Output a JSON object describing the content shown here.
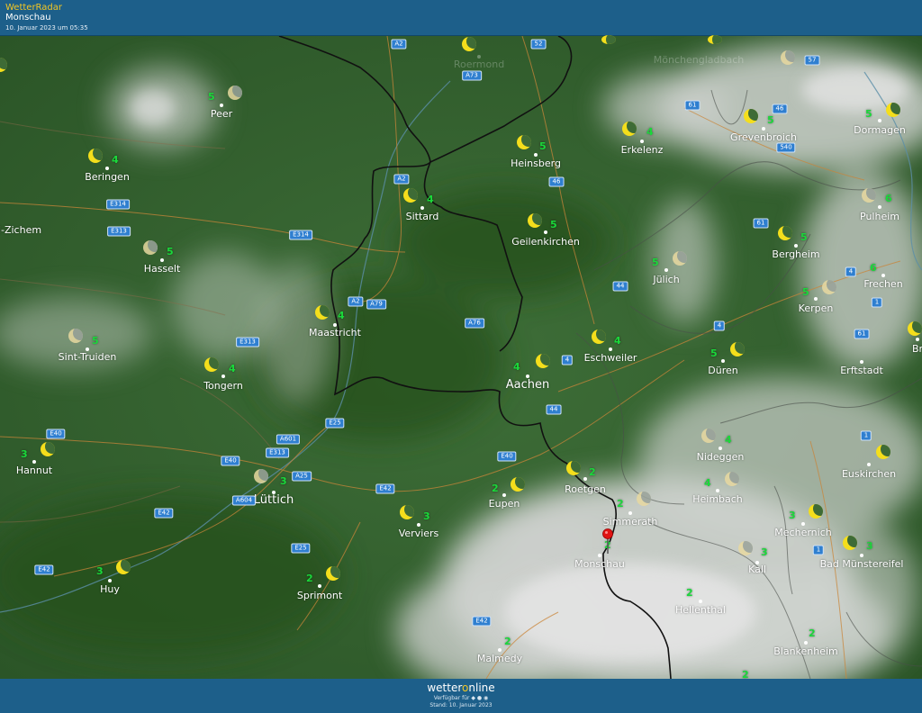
{
  "header": {
    "brand": "WetterRadar",
    "location": "Monschau",
    "timestamp": "10. Januar 2023 um 05:35"
  },
  "footer": {
    "logo_a": "wetter",
    "logo_b": "o",
    "logo_c": "nline",
    "available": "Verfügbar für ◆ ● ◉",
    "stand": "Stand: 10. Januar 2023"
  },
  "cities": [
    {
      "name": "Roermond",
      "faded": true
    },
    {
      "name": "Mönchengladbach",
      "faded": true
    },
    {
      "name": "Peer"
    },
    {
      "name": "Beringen"
    },
    {
      "name": "l-Zichem"
    },
    {
      "name": "Hasselt"
    },
    {
      "name": "Sint-Truiden"
    },
    {
      "name": "Tongern"
    },
    {
      "name": "Hannut"
    },
    {
      "name": "Huy"
    },
    {
      "name": "Lüttich",
      "big": true
    },
    {
      "name": "Sprimont"
    },
    {
      "name": "Verviers"
    },
    {
      "name": "Eupen"
    },
    {
      "name": "Malmedy"
    },
    {
      "name": "Maastricht"
    },
    {
      "name": "Sittard"
    },
    {
      "name": "Heinsberg"
    },
    {
      "name": "Geilenkirchen"
    },
    {
      "name": "Erkelenz"
    },
    {
      "name": "Grevenbroich"
    },
    {
      "name": "Dormagen"
    },
    {
      "name": "Pulheim"
    },
    {
      "name": "Bergheim"
    },
    {
      "name": "Frechen"
    },
    {
      "name": "Jülich"
    },
    {
      "name": "Kerpen"
    },
    {
      "name": "Aachen",
      "big": true
    },
    {
      "name": "Eschweiler"
    },
    {
      "name": "Düren"
    },
    {
      "name": "Erftstadt"
    },
    {
      "name": "Br"
    },
    {
      "name": "Nideggen"
    },
    {
      "name": "Euskirchen"
    },
    {
      "name": "Roetgen"
    },
    {
      "name": "Heimbach"
    },
    {
      "name": "Simmerath"
    },
    {
      "name": "Monschau"
    },
    {
      "name": "Mechernich"
    },
    {
      "name": "Kall"
    },
    {
      "name": "Bad Münstereifel"
    },
    {
      "name": "Hellenthal"
    },
    {
      "name": "Blankenheim"
    }
  ],
  "temps": [
    "5",
    "4",
    "5",
    "5",
    "4",
    "3",
    "3",
    "3",
    "2",
    "3",
    "2",
    "2",
    "4",
    "4",
    "5",
    "4",
    "5",
    "5",
    "5",
    "4",
    "6",
    "5",
    "6",
    "5",
    "4",
    "5",
    "4",
    "5",
    "4",
    "2",
    "4",
    "2",
    "2",
    "3",
    "3",
    "3",
    "2",
    "2",
    "2"
  ],
  "roads": [
    "A2",
    "52",
    "A73",
    "57",
    "46",
    "540",
    "61",
    "A2",
    "46",
    "E314",
    "E313",
    "E314",
    "61",
    "A2",
    "A79",
    "44",
    "4",
    "A76",
    "E313",
    "4",
    "1",
    "61",
    "44",
    "E25",
    "E40",
    "A601",
    "E313",
    "E40",
    "A25",
    "E40",
    "E42",
    "A604",
    "E42",
    "E25",
    "E42",
    "E42",
    "1",
    "4",
    "1"
  ],
  "colors": {
    "header_bg": "#1d5f8a",
    "temperature": "#1ad83a",
    "moon": "#f4de1c",
    "road_badge": "#2f7fd0",
    "forest": "#2d5a2a",
    "cloud": "#d8d8d8"
  }
}
